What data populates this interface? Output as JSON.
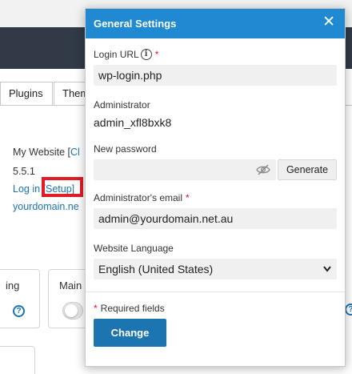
{
  "background": {
    "tabs": [
      "Plugins",
      "Themes"
    ],
    "site_info": {
      "name_prefix": "My Website [",
      "name_link_fragment": "Cl",
      "version": "5.5.1",
      "login_link": "Log in",
      "setup_link": "[Setup]",
      "domain_fragment": "yourdomain.ne"
    },
    "cards": {
      "left_label_fragment": "ing",
      "middle_label_fragment": "Main"
    },
    "colors": {
      "dark_bar": "#313a46",
      "link": "#1a73b7",
      "highlight": "#e21b24"
    }
  },
  "dialog": {
    "title": "General Settings",
    "close_icon": "close-icon",
    "login_url": {
      "label": "Login URL",
      "required_mark": "*",
      "value": "wp-login.php"
    },
    "administrator": {
      "label": "Administrator",
      "value": "admin_xfl8bxk8"
    },
    "new_password": {
      "label": "New password",
      "value": "",
      "toggle_icon": "eye-slash-icon",
      "generate_label": "Generate"
    },
    "admin_email": {
      "label": "Administrator's email",
      "required_mark": "*",
      "value": "admin@yourdomain.net.au"
    },
    "language": {
      "label": "Website Language",
      "selected": "English (United States)"
    },
    "required_note": {
      "mark": "*",
      "text": "Required fields"
    },
    "submit_label": "Change",
    "colors": {
      "header": "#1f89d1",
      "primary_button": "#1c74b1",
      "required": "#e0191f"
    }
  }
}
